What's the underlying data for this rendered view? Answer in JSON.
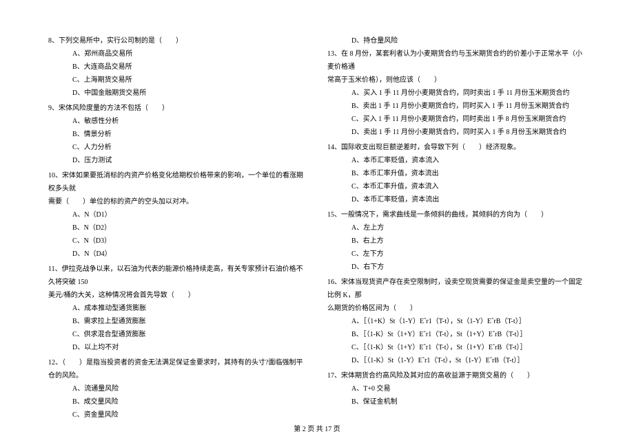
{
  "left_column": {
    "q8": {
      "text": "8、下列交易所中，实行公司制的是（　　）",
      "options": [
        "A、郑州商品交易所",
        "B、大连商品交易所",
        "C、上海期货交易所",
        "D、中国金融期货交易所"
      ]
    },
    "q9": {
      "text": "9、宋体风险度量的方法不包括（　　）",
      "options": [
        "A、敏感性分析",
        "B、情景分析",
        "C、人力分析",
        "D、压力测试"
      ]
    },
    "q10": {
      "text_l1": "10、宋体如果要抵消标的内资产价格变化给期权价格带来的影响，一个单位的看涨期权多头就",
      "text_l2": "需要（　　）单位的标的资产的空头加以对冲。",
      "options": [
        "A、N（D1）",
        "B、N（D2）",
        "C、N（D3）",
        "D、N（D4）"
      ]
    },
    "q11": {
      "text_l1": "11、伊拉克战争以来，以石油为代表的能源价格持续走高，有关专家预计石油价格不久将突破 150",
      "text_l2": "美元/桶的大关，这种情况将会首先导致（　　）",
      "options": [
        "A、成本推动型通货膨胀",
        "B、需求拉上型通货膨胀",
        "C、供求混合型通货膨胀",
        "D、以上均不对"
      ]
    },
    "q12": {
      "text": "12、（　　）是指当投资者的资金无法满足保证金要求时，其持有的头寸?面临强制平仓的风险。",
      "options": [
        "A、流通量风险",
        "B、成交量风险",
        "C、资金量风险"
      ]
    }
  },
  "right_column": {
    "q12d": "D、持仓量风险",
    "q13": {
      "text_l1": "13、在 8 月份，某套利者认为小麦期货合约与玉米期货合约的价差小于正常水平（小麦价格通",
      "text_l2": "常高于玉米价格），则他应该（　　）",
      "options": [
        "A、买入 1 手 11 月份小麦期货合约，同时卖出 1 手 11 月份玉米期货合约",
        "B、卖出 1 手 11 月份小麦期货合约，同时买入 1 手 11 月份玉米期货合约",
        "C、买入 1 手 11 月份小麦期货合约，同时卖出 1 手 8 月份玉米期货合约",
        "D、卖出 1 手 11 月份小麦期货合约，同时买入 1 手 8 月份玉米期货合约"
      ]
    },
    "q14": {
      "text": "14、国际收支出现巨额逆差时，会导致下列（　　）经济现象。",
      "options": [
        "A、本币汇率贬值，资本流入",
        "B、本币汇率升值，资本流出",
        "C、本币汇率升值，资本流入",
        "D、本币汇率贬值，资本流出"
      ]
    },
    "q15": {
      "text": "15、一般情况下，需求曲线是一条倾斜的曲线，其倾斜的方向为（　　）",
      "options": [
        "A、左上方",
        "B、右上方",
        "C、左下方",
        "D、右下方"
      ]
    },
    "q16": {
      "text_l1": "16、宋体当现货资产存在卖空限制时，设卖空现货需要的保证金是卖空量的一个固定比例 K，那",
      "text_l2": "么期货的价格区间为（　　）",
      "options": [
        "A、［（1+K）St（1-Y）Eˆr1（T-t），St（1-Y）EˆrB（T-t）］",
        "B、［（1-K）St（1+Y）Eˆr1（T-t），St（1+Y）EˆrB（T-t）］",
        "C、［（1-K）St（1+Y）Eˆr1（T-t），St（1+Y）EˆrB（T-t）］",
        "D、［（1-K）St（1-Y）Eˆr1（T-t），St（1-Y）EˆrB（T-t）］"
      ]
    },
    "q17": {
      "text": "17、宋体期货合约高风险及其对应的高收益源于期货交易的（　　）",
      "options": [
        "A、T+0 交易",
        "B、保证金机制"
      ]
    }
  },
  "footer": "第 2 页 共 17 页"
}
